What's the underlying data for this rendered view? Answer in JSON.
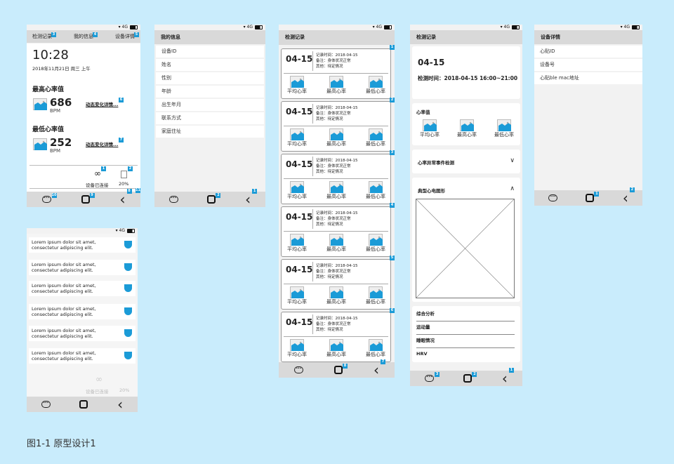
{
  "status": {
    "network": "4G"
  },
  "colors": {
    "background": "#c9ecfc",
    "badge": "#1b9bd7",
    "image_fill": "#1b9bd7"
  },
  "home": {
    "tabs": [
      {
        "label": "检测记录",
        "badge": "3"
      },
      {
        "label": "我的信息",
        "badge": "4"
      },
      {
        "label": "设备详情",
        "badge": "5"
      }
    ],
    "time": "10:28",
    "date": "2018年11月21日  周三  上午",
    "max_title": "最高心率值",
    "max_value": "686",
    "unit": "BPM",
    "detail_link": "动态变化详情...",
    "max_badge": "6",
    "min_title": "最低心率值",
    "min_value": "252",
    "min_badge": "7",
    "connected": "设备已连接",
    "connected_badge": "1",
    "battery": "20%",
    "battery_badge": "2",
    "nav_badges": [
      "10",
      "9",
      "8"
    ],
    "corner_badge": "11"
  },
  "info": {
    "title": "我的信息",
    "items": [
      "设备ID",
      "姓名",
      "性别",
      "年龄",
      "出生年月",
      "联系方式",
      "家庭住址"
    ],
    "nav_badges": [
      "",
      "2",
      "1"
    ]
  },
  "records": {
    "title": "检测记录",
    "card": {
      "date": "04-15",
      "line1": "记录时间：2018-04-15",
      "line2": "备注：身体状况正常",
      "line3": "其他：待定情况",
      "labels": [
        "平均心率",
        "最高心率",
        "最低心率"
      ]
    },
    "badges": [
      "1",
      "2",
      "3",
      "4",
      "5",
      "6"
    ],
    "nav_badges": [
      "",
      "8",
      "7"
    ]
  },
  "detail": {
    "title": "检测记录",
    "date": "04-15",
    "time": "检测时间：2018-04-15   16:00~21:00",
    "hr_title": "心率值",
    "labels": [
      "平均心率",
      "最高心率",
      "最低心率"
    ],
    "abnormal": "心率异常事件检测",
    "ecg": "典型心电图形",
    "analysis": [
      "综合分析",
      "运动量",
      "睡眠情况",
      "HRV"
    ],
    "nav_badges": [
      "3",
      "2",
      "1"
    ]
  },
  "device": {
    "title": "设备详情",
    "items": [
      "心贴ID",
      "设备号",
      "心贴ble mac地址"
    ],
    "nav_badges": [
      "",
      "1",
      "2"
    ]
  },
  "notify": {
    "items": [
      "Lorem ipsum dolor sit amet, consectetur adipiscing elit.",
      "Lorem ipsum dolor sit amet, consectetur adipiscing elit.",
      "Lorem ipsum dolor sit amet, consectetur adipiscing elit.",
      "Lorem ipsum dolor sit amet, consectetur adipiscing elit.",
      "Lorem ipsum dolor sit amet, consectetur adipiscing elit.",
      "Lorem ipsum dolor sit amet, consectetur adipiscing elit."
    ]
  },
  "caption": "图1-1 原型设计1"
}
